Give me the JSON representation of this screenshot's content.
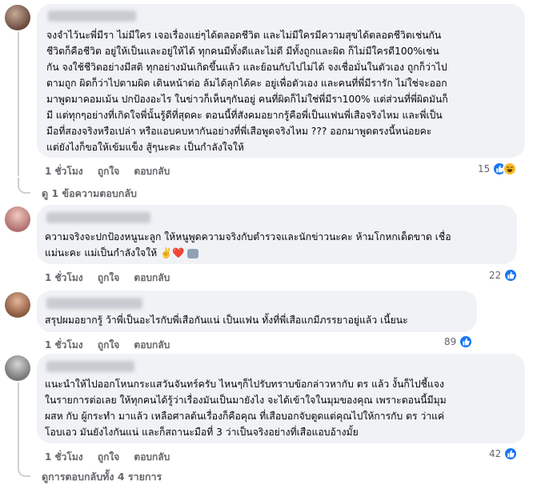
{
  "comments": [
    {
      "lines": [
        "จงจำไว้นะพี่มีรา ไม่มีใคร เจอเรื่องแย่ๆได้ตลอดชีวิต และไม่มีใครมีความสุขได้ตลอดชีวิตเช่นกัน",
        "ชีวิตก็คือชีวิต อยู่ให้เป็นและอยู่ให้ได้ ทุกคนมีทั้งดีและไม่ดี มีทั้งถูกและผิด ก็ไม่มีใครดี100%เช่น",
        "กัน จงใช้ชีวิตอย่างมีสติ ทุกอย่างมันเกิดขึ้นแล้ว และย้อนกับไปไม่ได้ จงเชื่อมั่นในตัวเอง ถูกก็ว่าไป",
        "ตามถูก ผิดก็ว่าไปตามผิด เดินหน้าต่อ ล้มได้ลุกได้คะ อยู่เพื่อตัวเอง และคนที่พี่มีรารัก ไม่ใช่จะออก",
        "มาพูดมาคอมเม้น ปกป้องอะไร ในข่าวก็เห็นๆกันอยู่ คนที่ผิดก็ไม่ใช่พี่มีรา100% แต่ส่วนที่พี่ผิดมันก็",
        "มี แต่ทุกๆอย่างที่เกิดใจพี่นั้นรู้ดีที่สุดคะ ตอนนี้ที่สังคมอยากรู้คือพี่เป็นแฟนพี่เสือจริงไหม และพี่เป็น",
        "มือที่สองจริงหรือเปล่า หรือแอบคบหากันอย่างที่พี่เสือพูดจริงไหม ??? ออกมาพูดตรงนี้หน่อยคะ",
        "แต่ยังไงก็ขอให้เข้มแข็ง สู้ๆนะคะ เป็นกำลังใจให้"
      ],
      "time": "1 ชั่วโมง",
      "like": "ถูกใจ",
      "reply": "ตอบกลับ",
      "reaction_count": "15",
      "reactions": [
        "like-icon",
        "haha-icon"
      ],
      "view_replies": "ดู 1 ข้อความตอบกลับ"
    },
    {
      "lines": [
        "ความจริงจะปกป้องหนูนะลูก ให้หนูพูดความจริงกับตำรวจและนักข่าวนะคะ ห้ามโกหกเด็ดขาด เชื่อ",
        "แม่นะคะ แม่เป็นกำลังใจให้"
      ],
      "emojis": "✌️❤️",
      "time": "1 ชั่วโมง",
      "like": "ถูกใจ",
      "reply": "ตอบกลับ",
      "reaction_count": "22",
      "reactions": [
        "like-icon"
      ]
    },
    {
      "lines": [
        "สรุปผมอยากรู้ ว้าพี่เป็นอะไรกับพี่เสือกันแน่ เป็นแฟน ทั้งที่พี่เสือแกมีภรรยาอยู่แล้ว เนี้ยนะ"
      ],
      "time": "1 ชั่วโมง",
      "like": "ถูกใจ",
      "reply": "ตอบกลับ",
      "reaction_count": "89",
      "reactions": [
        "like-icon"
      ]
    },
    {
      "lines": [
        "แนะนำให้ไปออกโหนกระแสวันจันทร์ครับ ไหนๆก็ไปรับทราบข้อกล่าวหากับ ตร แล้ว งั้นก็ไปชี้แจง",
        "ในรายการต่อเลย ให้ทุกคนได้รู้ว่าเรื่องมันเป็นมายังไง จะได้เข้าใจในมุมของคุณ เพราะตอนนี้มีมุม",
        "ผสห กับ ผู้กระทำ มาแล้ว เหลือศาลต้นเรื่องก็คือคุณ ที่เสือบอกจับตูดแต่คุณไปให้การกับ ตร ว่าแค่",
        "โอบเอว มันยังไงกันแน่ และก็สถานะมือที่ 3 ว่าเป็นจริงอย่างที่เสือแอบอ้างมั้ย"
      ],
      "time": "1 ชั่วโมง",
      "like": "ถูกใจ",
      "reply": "ตอบกลับ",
      "reaction_count": "42",
      "reactions": [
        "like-icon"
      ],
      "view_replies": "ดูการตอบกลับทั้ง 4 รายการ"
    }
  ],
  "colors": {
    "bubble": "#f0f2f5",
    "meta": "#65676b",
    "like_blue": "#1877f2",
    "haha_yellow": "#f7b928"
  }
}
